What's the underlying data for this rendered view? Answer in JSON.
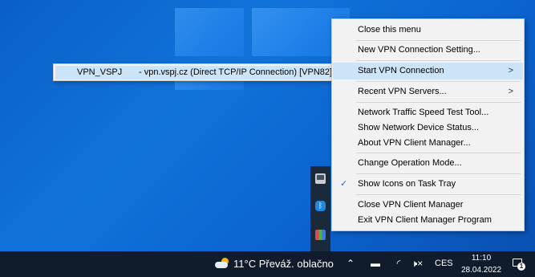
{
  "context_menu": {
    "items": [
      {
        "label": "Close this menu"
      },
      {
        "label": "New VPN Connection Setting..."
      },
      {
        "label": "Start VPN Connection",
        "arrow": ">"
      },
      {
        "label": "Recent VPN Servers...",
        "arrow": ">"
      },
      {
        "label": "Network Traffic Speed Test Tool..."
      },
      {
        "label": "Show Network Device Status..."
      },
      {
        "label": "About VPN Client Manager..."
      },
      {
        "label": "Change Operation Mode..."
      },
      {
        "label": "Show Icons on Task Tray",
        "check": "✓"
      },
      {
        "label": "Close VPN Client Manager"
      },
      {
        "label": "Exit VPN Client Manager Program"
      }
    ],
    "highlight_color": "#cce4f7"
  },
  "submenu": {
    "name": "VPN_VSPJ",
    "detail": "- vpn.vspj.cz (Direct TCP/IP Connection) [VPN82]"
  },
  "tray_overflow": {
    "icons": [
      "monitor-icon",
      "bluetooth-icon",
      "app-icon"
    ],
    "bluetooth_glyph": "ᛒ"
  },
  "taskbar": {
    "weather": "11°C  Převáž. oblačno",
    "chevron": "⌃",
    "network_glyph": "▬",
    "wifi_glyph": "◜",
    "volume_glyph": "🕨×",
    "language": "CES",
    "time": "11:10",
    "date": "28.04.2022",
    "notification_count": "1",
    "background_color": "#101c2c"
  }
}
